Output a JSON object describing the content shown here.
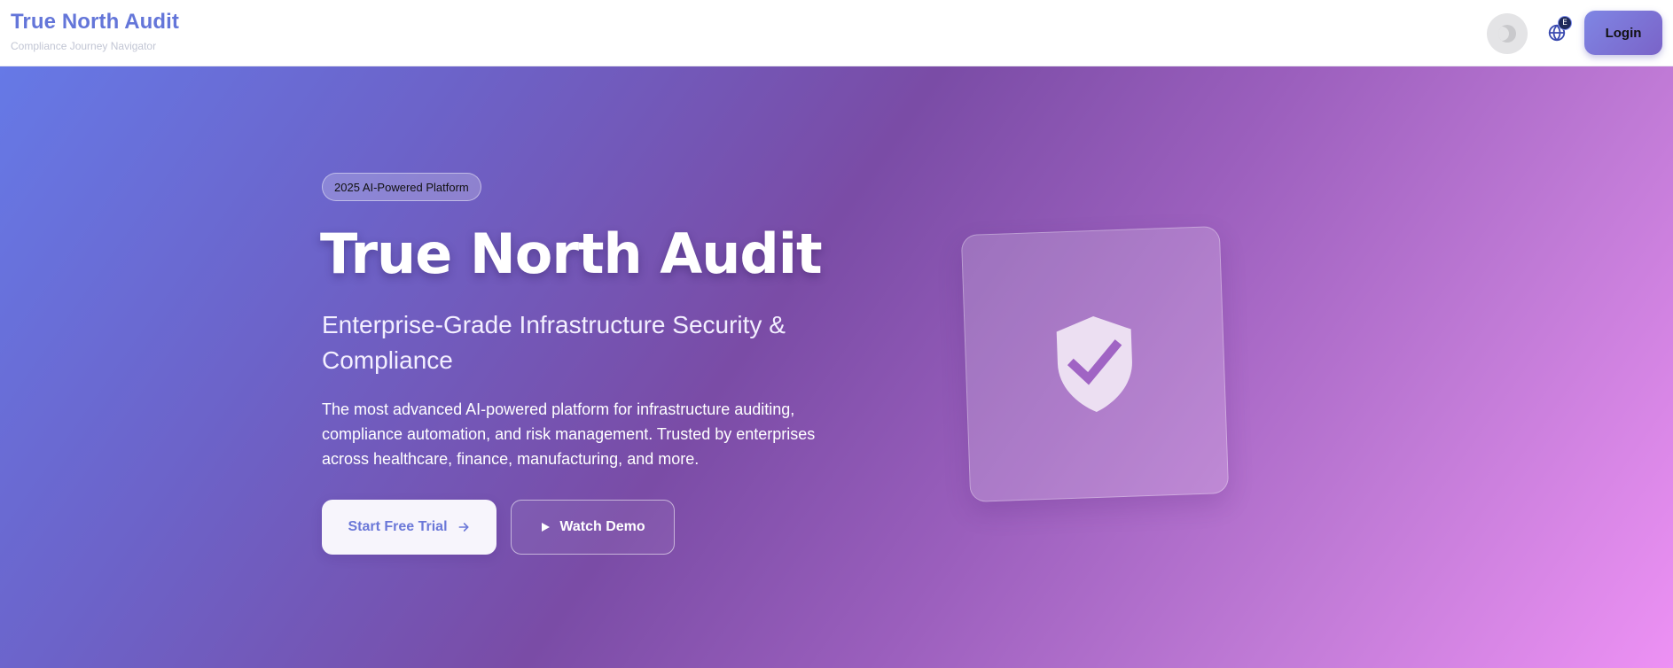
{
  "brand": {
    "title": "True North Audit",
    "subtitle": "Compliance Journey Navigator"
  },
  "nav": {
    "theme_icon": "moon-icon",
    "language_icon": "globe-icon",
    "language_badge": "E",
    "login_label": "Login"
  },
  "hero": {
    "badge": "2025 AI-Powered Platform",
    "title": "True North Audit",
    "subtitle": "Enterprise-Grade Infrastructure Security & Compliance",
    "description": "The most advanced AI-powered platform for infrastructure auditing, compliance automation, and risk management. Trusted by enterprises across healthcare, finance, manufacturing, and more.",
    "primary_cta": "Start Free Trial",
    "primary_cta_icon": "arrow-right-icon",
    "secondary_cta": "Watch Demo",
    "secondary_cta_icon": "play-icon",
    "card_icon": "shield-check-icon"
  },
  "colors": {
    "brand": "#6476d9",
    "gradient_start": "#6679e6",
    "gradient_mid": "#7a4ca6",
    "gradient_end": "#ed91f4"
  }
}
